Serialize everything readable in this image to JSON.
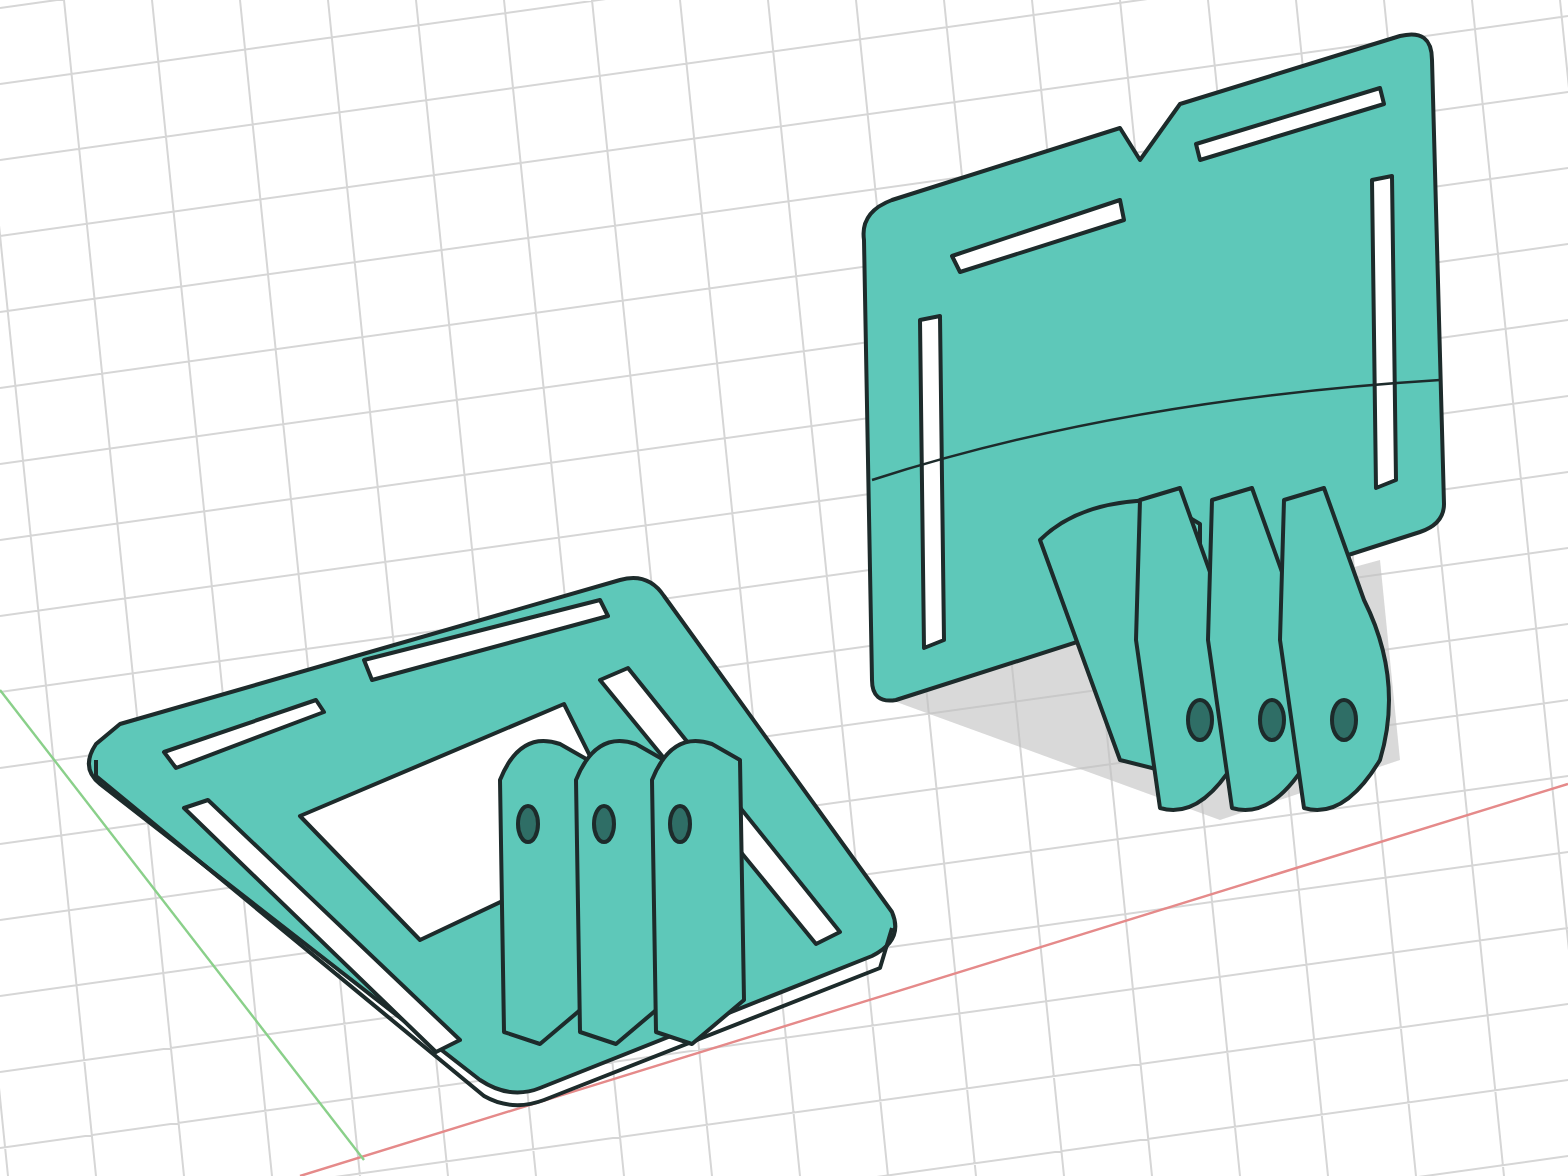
{
  "viewport": {
    "grid": true,
    "origin_axes": true
  }
}
